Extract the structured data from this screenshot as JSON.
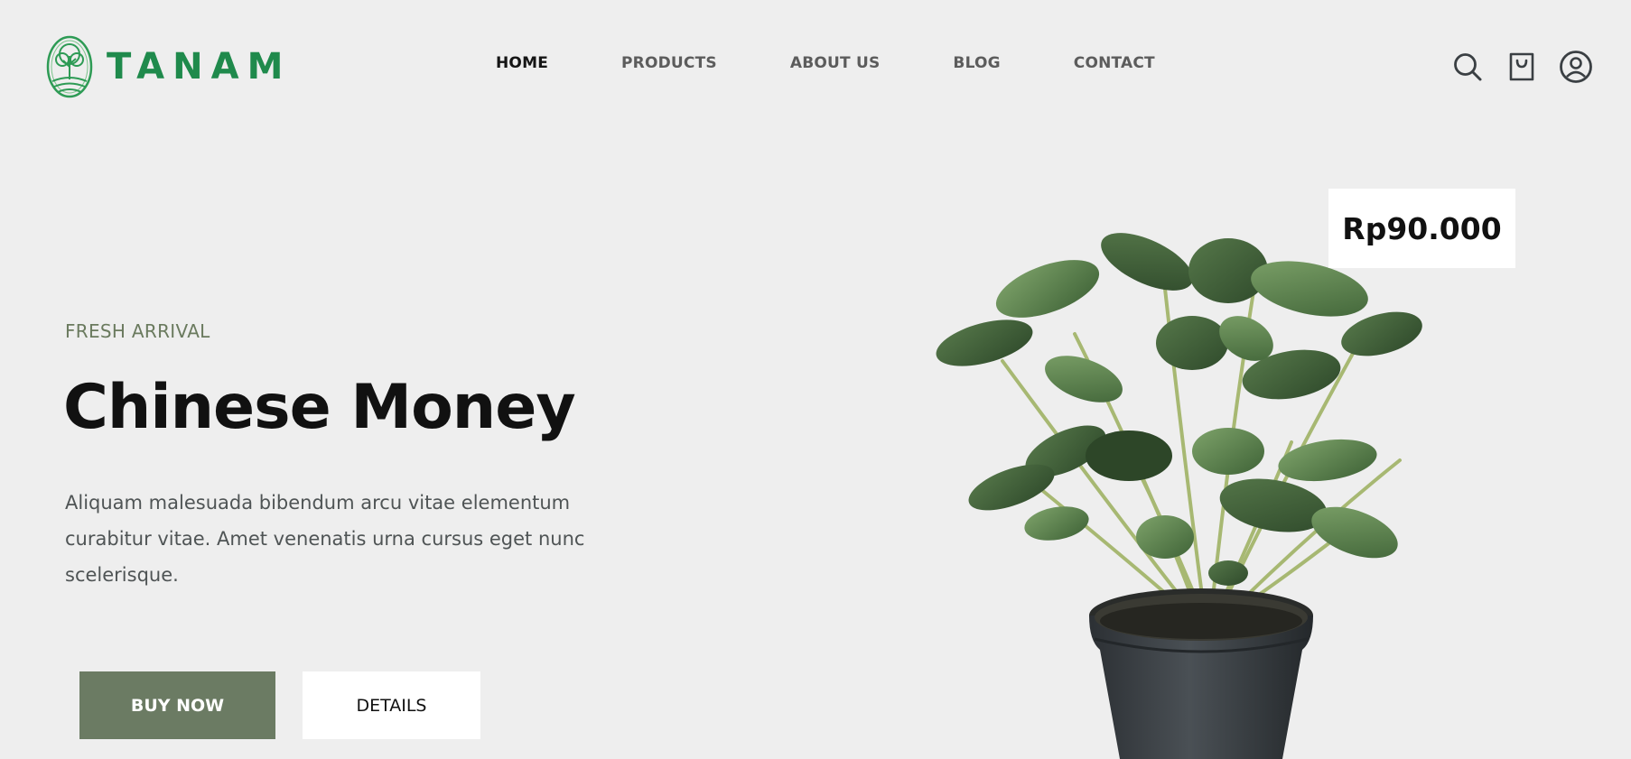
{
  "brand": {
    "name": "TANAM",
    "color": "#1f8a4c",
    "logo_icon": "tree-in-circle-logo"
  },
  "nav": {
    "items": [
      {
        "label": "HOME",
        "active": true
      },
      {
        "label": "PRODUCTS",
        "active": false
      },
      {
        "label": "ABOUT US",
        "active": false
      },
      {
        "label": "BLOG",
        "active": false
      },
      {
        "label": "CONTACT",
        "active": false
      }
    ]
  },
  "header_icons": [
    "search-icon",
    "shopping-bag-icon",
    "user-account-icon"
  ],
  "hero": {
    "eyebrow": "FRESH ARRIVAL",
    "title": "Chinese Money",
    "description": "Aliquam malesuada bibendum arcu vitae elementum curabitur vitae. Amet venenatis urna cursus eget nunc scelerisque.",
    "buy_label": "BUY NOW",
    "details_label": "DETAILS",
    "price": "Rp90.000",
    "accent_color": "#6b7b63",
    "product_image": "potted-plant-image"
  }
}
